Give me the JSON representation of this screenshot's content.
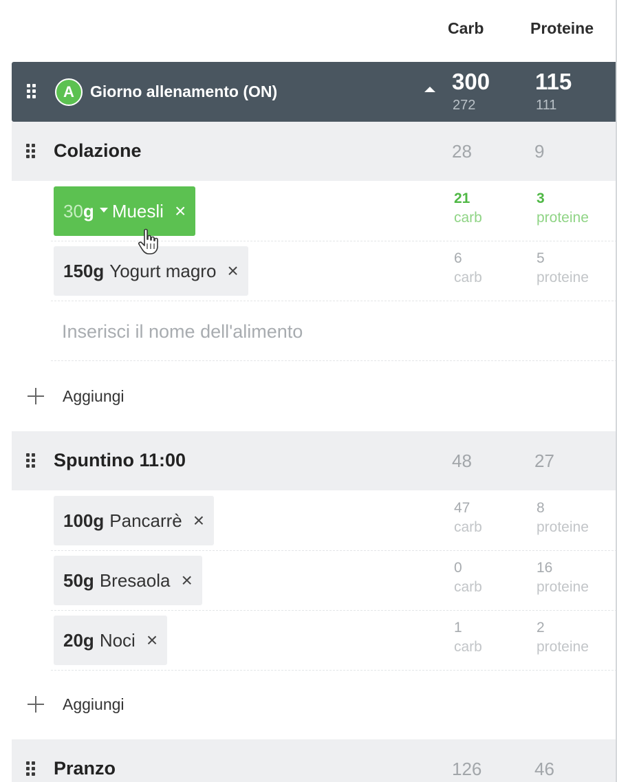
{
  "columns": {
    "carb": "Carb",
    "proteine": "Proteine"
  },
  "day": {
    "badge": "A",
    "title": "Giorno allenamento (ON)",
    "carb_target": "300",
    "carb_actual": "272",
    "prot_target": "115",
    "prot_actual": "111"
  },
  "meals": [
    {
      "name": "Colazione",
      "carb": "28",
      "prot": "9",
      "foods": [
        {
          "qty_num": "30",
          "qty_unit": "g",
          "name": "Muesli",
          "carb": "21",
          "prot": "3",
          "active": true
        },
        {
          "qty": "150g",
          "name": "Yogurt magro",
          "carb": "6",
          "prot": "5"
        }
      ],
      "search_placeholder": "Inserisci il nome dell'alimento",
      "add_label": "Aggiungi"
    },
    {
      "name": "Spuntino 11:00",
      "carb": "48",
      "prot": "27",
      "foods": [
        {
          "qty": "100g",
          "name": "Pancarrè",
          "carb": "47",
          "prot": "8"
        },
        {
          "qty": "50g",
          "name": "Bresaola",
          "carb": "0",
          "prot": "16"
        },
        {
          "qty": "20g",
          "name": "Noci",
          "carb": "1",
          "prot": "2"
        }
      ],
      "add_label": "Aggiungi"
    },
    {
      "name": "Pranzo",
      "carb": "126",
      "prot": "46"
    }
  ],
  "labels": {
    "carb": "carb",
    "proteine": "proteine",
    "remove": "×"
  },
  "colors": {
    "header_bg": "#4a5660",
    "accent_green": "#5cc151",
    "meal_bg": "#eeeff1"
  },
  "icons": {
    "grip": "drag-handle-icon",
    "collapse": "caret-up-icon",
    "add": "plus-icon",
    "remove": "close-icon",
    "cursor": "hand-pointer-icon"
  }
}
